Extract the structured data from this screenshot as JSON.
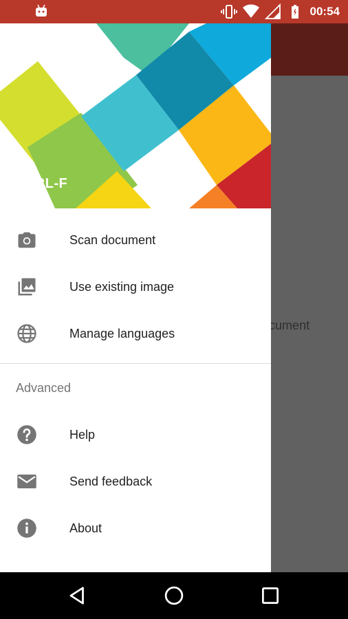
{
  "status_bar": {
    "time": "00:54",
    "icons": [
      "android-icon",
      "vibrate-icon",
      "wifi-icon",
      "signal-icon",
      "battery-icon"
    ]
  },
  "app": {
    "background_text": "Scan document"
  },
  "drawer": {
    "header_title": "CTRL-F",
    "items": [
      {
        "label": "Scan document",
        "icon": "camera-icon"
      },
      {
        "label": "Use existing image",
        "icon": "image-icon"
      },
      {
        "label": "Manage languages",
        "icon": "globe-icon"
      }
    ],
    "advanced_section": {
      "title": "Advanced",
      "items": [
        {
          "label": "Help",
          "icon": "help-icon"
        },
        {
          "label": "Send feedback",
          "icon": "mail-icon"
        },
        {
          "label": "About",
          "icon": "info-icon"
        }
      ]
    }
  },
  "nav_bar": {
    "buttons": [
      "back-icon",
      "home-icon",
      "recents-icon"
    ]
  },
  "colors": {
    "status_bar": "#b8382a",
    "app_bar_dimmed": "#5a1d18",
    "scrim": "#616161",
    "icon_gray": "#757575"
  }
}
